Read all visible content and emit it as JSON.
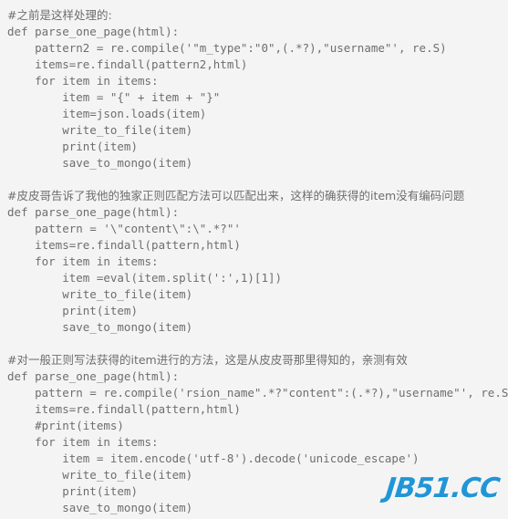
{
  "page": {
    "background_color": "#f4f4f4",
    "text_color": "#6e6e6e",
    "watermark": "JB51.CC",
    "watermark_color": "#2196d6"
  },
  "code": {
    "language": "python",
    "lines": [
      "#之前是这样处理的:",
      "def parse_one_page(html):",
      "    pattern2 = re.compile('\"m_type\":\"0\",(.*?),\"username\"', re.S)",
      "    items=re.findall(pattern2,html)",
      "    for item in items:",
      "        item = \"{\" + item + \"}\"",
      "        item=json.loads(item)",
      "        write_to_file(item)",
      "        print(item)",
      "        save_to_mongo(item)",
      "",
      "#皮皮哥告诉了我他的独家正则匹配方法可以匹配出来，这样的确获得的item没有编码问题",
      "def parse_one_page(html):",
      "    pattern = '\\\"content\\\":\\\".*?\"'",
      "    items=re.findall(pattern,html)",
      "    for item in items:",
      "        item =eval(item.split(':',1)[1])",
      "        write_to_file(item)",
      "        print(item)",
      "        save_to_mongo(item)",
      "",
      "#对一般正则写法获得的item进行的方法，这是从皮皮哥那里得知的，亲测有效",
      "def parse_one_page(html):",
      "    pattern = re.compile('rsion_name\".*?\"content\":(.*?),\"username\"', re.S)",
      "    items=re.findall(pattern,html)",
      "    #print(items)",
      "    for item in items:",
      "        item = item.encode('utf-8').decode('unicode_escape')",
      "        write_to_file(item)",
      "        print(item)",
      "        save_to_mongo(item)"
    ]
  }
}
